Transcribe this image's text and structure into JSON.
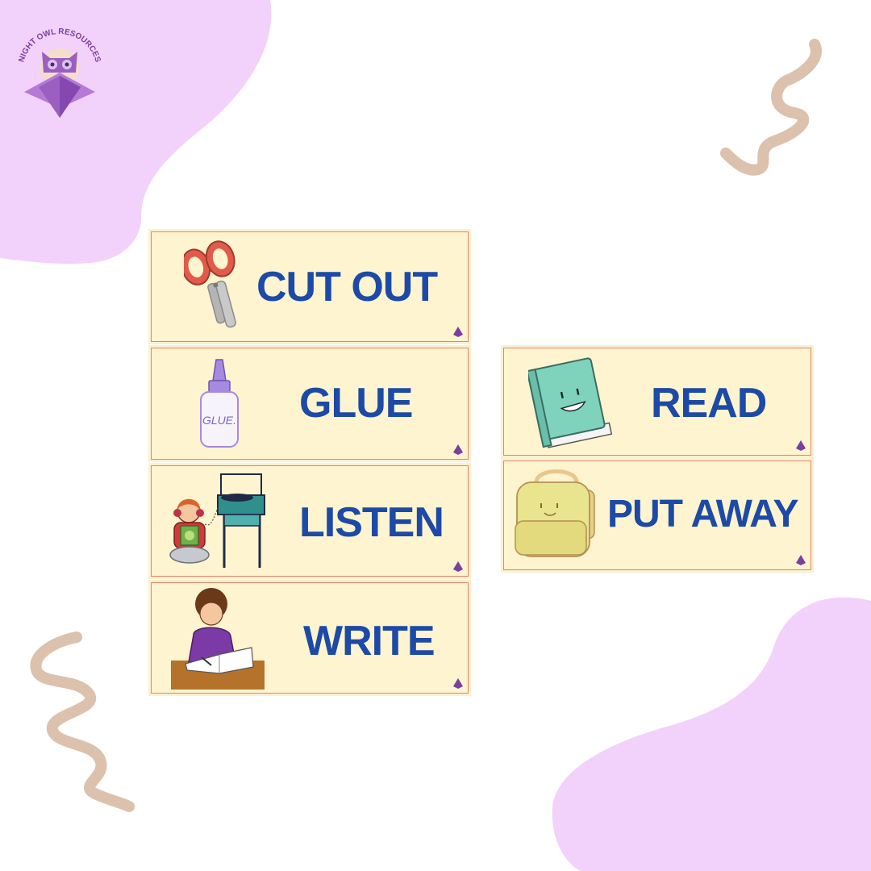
{
  "brand": {
    "name": "NIGHT OWL RESOURCES"
  },
  "cards": [
    {
      "label": "CUT OUT",
      "icon": "scissors-icon"
    },
    {
      "label": "GLUE",
      "icon": "glue-bottle-icon",
      "icon_text": "GLUE."
    },
    {
      "label": "LISTEN",
      "icon": "child-record-player-icon"
    },
    {
      "label": "WRITE",
      "icon": "child-writing-icon"
    },
    {
      "label": "READ",
      "icon": "smiling-book-icon"
    },
    {
      "label": "PUT AWAY",
      "icon": "backpack-icon"
    }
  ],
  "colors": {
    "card_bg": "#fef4cf",
    "card_border": "#e2866a",
    "label_text": "#1d4aa6",
    "blob": "#f2d2fb",
    "squiggle": "#dcc1ad"
  }
}
